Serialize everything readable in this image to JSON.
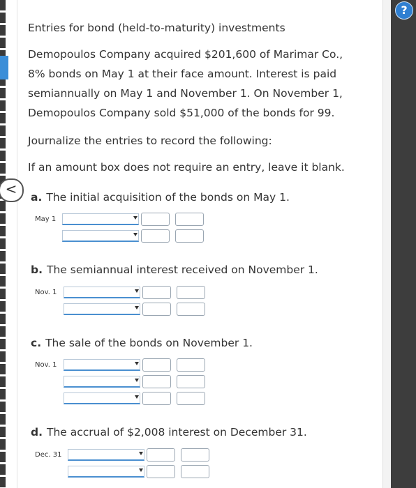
{
  "title": "Entries for bond (held-to-maturity) investments",
  "problem_lines": [
    "Demopoulos Company acquired $201,600 of Marimar Co.,",
    "8% bonds on May 1 at their face amount. Interest is paid",
    "semiannually on May 1 and November 1. On November 1,",
    "Demopoulos Company sold $51,000 of the bonds for 99."
  ],
  "instruction": "Journalize the entries to record the following:",
  "note": "If an amount box does not require an entry, leave it blank.",
  "parts": [
    {
      "letter": "a.",
      "text": "The initial acquisition of the bonds on May 1.",
      "date": "May 1"
    },
    {
      "letter": "b.",
      "text": "The semiannual interest received on November 1.",
      "date": "Nov. 1"
    },
    {
      "letter": "c.",
      "text": "The sale of the bonds on November 1.",
      "date": "Nov. 1"
    },
    {
      "letter": "d.",
      "text": "The accrual of $2,008 interest on December 31.",
      "date": "Dec. 31"
    }
  ],
  "icons": {
    "help": "help-icon",
    "collapse": "chevron-left-icon"
  },
  "colors": {
    "accent": "#2f7fd1",
    "sidebar": "#3d3d3d",
    "text": "#333333"
  },
  "glyphs": {
    "help": "?",
    "collapse": "<"
  }
}
